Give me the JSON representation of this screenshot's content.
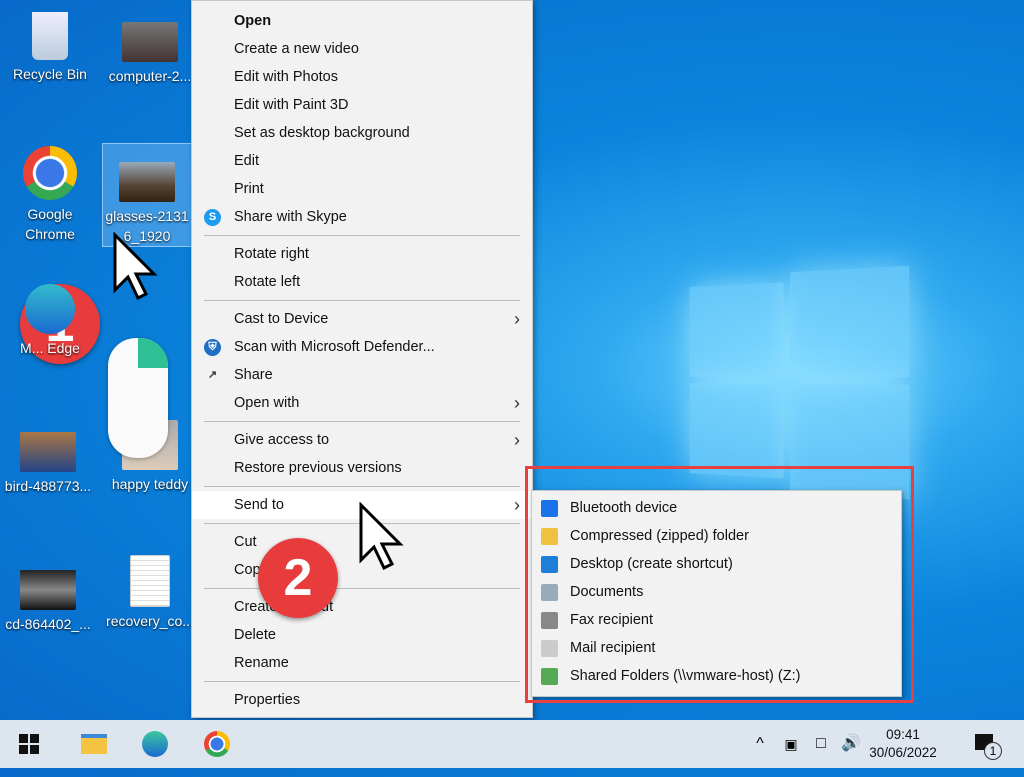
{
  "desktop": {
    "icons": [
      {
        "label": "Recycle Bin",
        "icon": "recycle-bin-icon"
      },
      {
        "label": "computer-2...",
        "icon": "image-icon"
      },
      {
        "label": "Google Chrome",
        "icon": "chrome-icon"
      },
      {
        "label": "glasses-2131 6_1920",
        "icon": "image-icon"
      },
      {
        "label": "M... Edge",
        "icon": "edge-icon"
      },
      {
        "label": "bird-488773...",
        "icon": "image-icon"
      },
      {
        "label": "happy teddy",
        "icon": "image-icon"
      },
      {
        "label": "cd-864402_...",
        "icon": "image-icon"
      },
      {
        "label": "recovery_co...",
        "icon": "document-icon"
      }
    ]
  },
  "context_menu": {
    "items": [
      {
        "label": "Open"
      },
      {
        "label": "Create a new video"
      },
      {
        "label": "Edit with Photos"
      },
      {
        "label": "Edit with Paint 3D"
      },
      {
        "label": "Set as desktop background"
      },
      {
        "label": "Edit"
      },
      {
        "label": "Print"
      },
      {
        "label": "Share with Skype",
        "icon": "skype-icon"
      },
      {
        "label": "Rotate right"
      },
      {
        "label": "Rotate left"
      },
      {
        "label": "Cast to Device"
      },
      {
        "label": "Scan with Microsoft Defender...",
        "icon": "defender-shield-icon"
      },
      {
        "label": "Share",
        "icon": "share-icon"
      },
      {
        "label": "Open with"
      },
      {
        "label": "Give access to"
      },
      {
        "label": "Restore previous versions"
      },
      {
        "label": "Send to"
      },
      {
        "label": "Cut"
      },
      {
        "label": "Copy"
      },
      {
        "label": "Create shortcut"
      },
      {
        "label": "Delete"
      },
      {
        "label": "Rename"
      },
      {
        "label": "Properties"
      }
    ]
  },
  "send_to_menu": {
    "items": [
      {
        "label": "Bluetooth device",
        "icon": "bluetooth-icon"
      },
      {
        "label": "Compressed (zipped) folder",
        "icon": "zip-folder-icon"
      },
      {
        "label": "Desktop (create shortcut)",
        "icon": "desktop-icon"
      },
      {
        "label": "Documents",
        "icon": "documents-icon"
      },
      {
        "label": "Fax recipient",
        "icon": "fax-icon"
      },
      {
        "label": "Mail recipient",
        "icon": "mail-icon"
      },
      {
        "label": "Shared Folders (\\\\vmware-host) (Z:)",
        "icon": "network-drive-icon"
      }
    ]
  },
  "annotations": {
    "step1": "1",
    "step2": "2",
    "highlight_color": "#e8403f"
  },
  "taskbar": {
    "time": "09:41",
    "date": "30/06/2022",
    "notifications": "1"
  }
}
